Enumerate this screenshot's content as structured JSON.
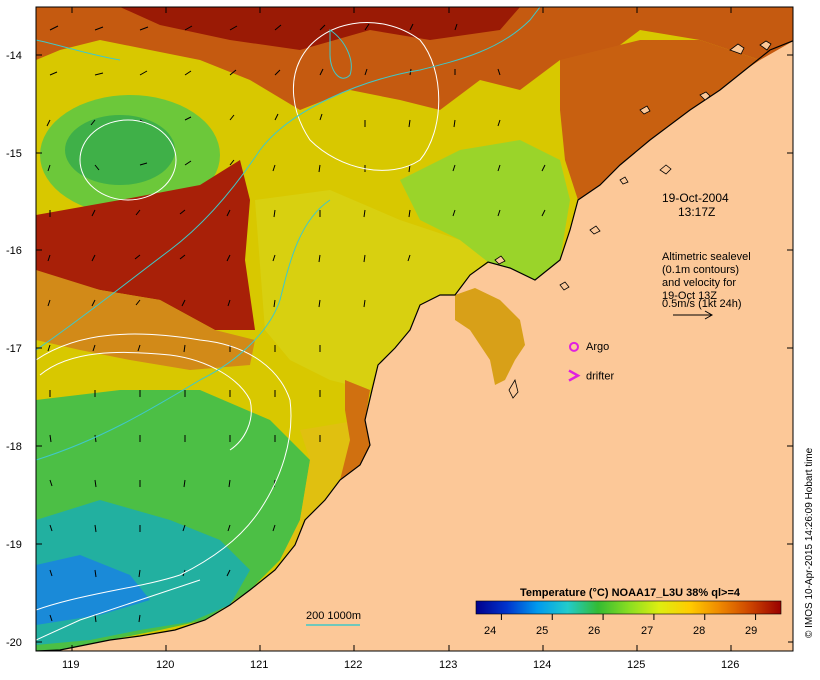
{
  "map": {
    "lat_ticks": [
      "-14",
      "-15",
      "-16",
      "-17",
      "-18",
      "-19",
      "-20"
    ],
    "lon_ticks": [
      "119",
      "120",
      "121",
      "122",
      "123",
      "124",
      "125",
      "126"
    ],
    "lat_range": [
      -20.1,
      -13.6
    ],
    "lon_range": [
      118.65,
      126.6
    ]
  },
  "annotations": {
    "date_line1": "19-Oct-2004",
    "date_line2": "13:17Z",
    "legend_line1": "Altimetric sealevel",
    "legend_line2": "(0.1m contours)",
    "legend_line3": "and velocity for",
    "legend_line4": "19-Oct 13Z",
    "legend_line5": "0.5m/s (1kt 24h)",
    "argo_label": "Argo",
    "drifter_label": "drifter",
    "isobath_label": "200 1000m",
    "argo_lon": 124.3,
    "argo_lat": -17.03,
    "drifter_lon": 124.3,
    "drifter_lat": -17.32
  },
  "colorbar": {
    "title": "Temperature (°C) NOAA17_L3U 38% ql>=4",
    "ticks": [
      "24",
      "25",
      "26",
      "27",
      "28",
      "29"
    ],
    "range": [
      23.5,
      29.5
    ],
    "colors": [
      "#00008c",
      "#0033cc",
      "#0099ee",
      "#22cccc",
      "#33bb33",
      "#88dd22",
      "#ddee11",
      "#ffcc00",
      "#ee8800",
      "#cc4400",
      "#990000"
    ]
  },
  "credit": "© IMOS 10-Apr-2015 14:26:09 Hobart time",
  "colors": {
    "land": "#fcc898",
    "isobath": "#40c8c8",
    "sealevel_contour": "#ffffff",
    "argo": "#e020e0",
    "drifter": "#e020e0"
  }
}
